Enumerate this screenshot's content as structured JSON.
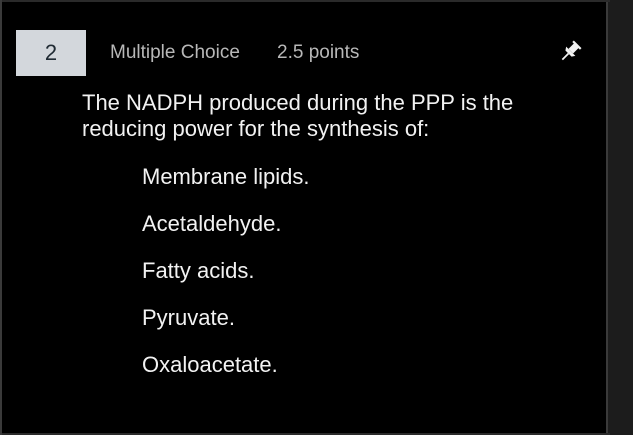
{
  "question": {
    "number": "2",
    "type": "Multiple Choice",
    "points": "2.5 points",
    "text": "The NADPH produced during the PPP is the reducing power for the synthesis of:",
    "pin_icon": "pin-icon"
  },
  "options": [
    {
      "label": "Membrane lipids."
    },
    {
      "label": "Acetaldehyde."
    },
    {
      "label": "Fatty acids."
    },
    {
      "label": "Pyruvate."
    },
    {
      "label": "Oxaloacetate."
    }
  ],
  "colors": {
    "background": "#000000",
    "number_box": "#d3d7dc",
    "text": "#f2f2f2",
    "meta_text": "#b8b8b8"
  }
}
